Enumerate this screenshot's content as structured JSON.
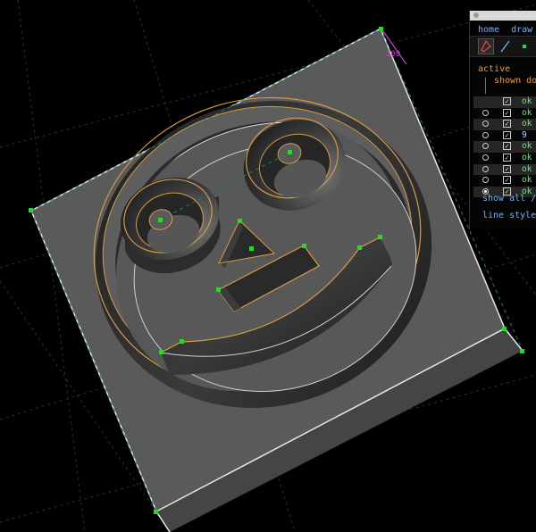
{
  "viewport": {
    "dimension_label": "100",
    "colors": {
      "background": "#000000",
      "face": "#5a5a5a",
      "edge_highlight": "#d79a45",
      "vertex": "#22dd22",
      "dimension": "#d23cd2"
    }
  },
  "panel": {
    "menu": {
      "home": "home",
      "draw": "draw"
    },
    "tools": {
      "select_icon": "select-tool-icon",
      "line_icon": "line-tool-icon",
      "point_icon": "point-tool-icon"
    },
    "active_label": "active",
    "shown_label": "shown",
    "done_label": "do",
    "rows": [
      {
        "status": "ok"
      },
      {
        "status": "ok"
      },
      {
        "status": "ok"
      },
      {
        "status": "9"
      },
      {
        "status": "ok"
      },
      {
        "status": "ok"
      },
      {
        "status": "ok"
      },
      {
        "status": "ok"
      },
      {
        "status": "ok"
      }
    ],
    "show_all": "show all /",
    "line_styles": "line styles"
  }
}
